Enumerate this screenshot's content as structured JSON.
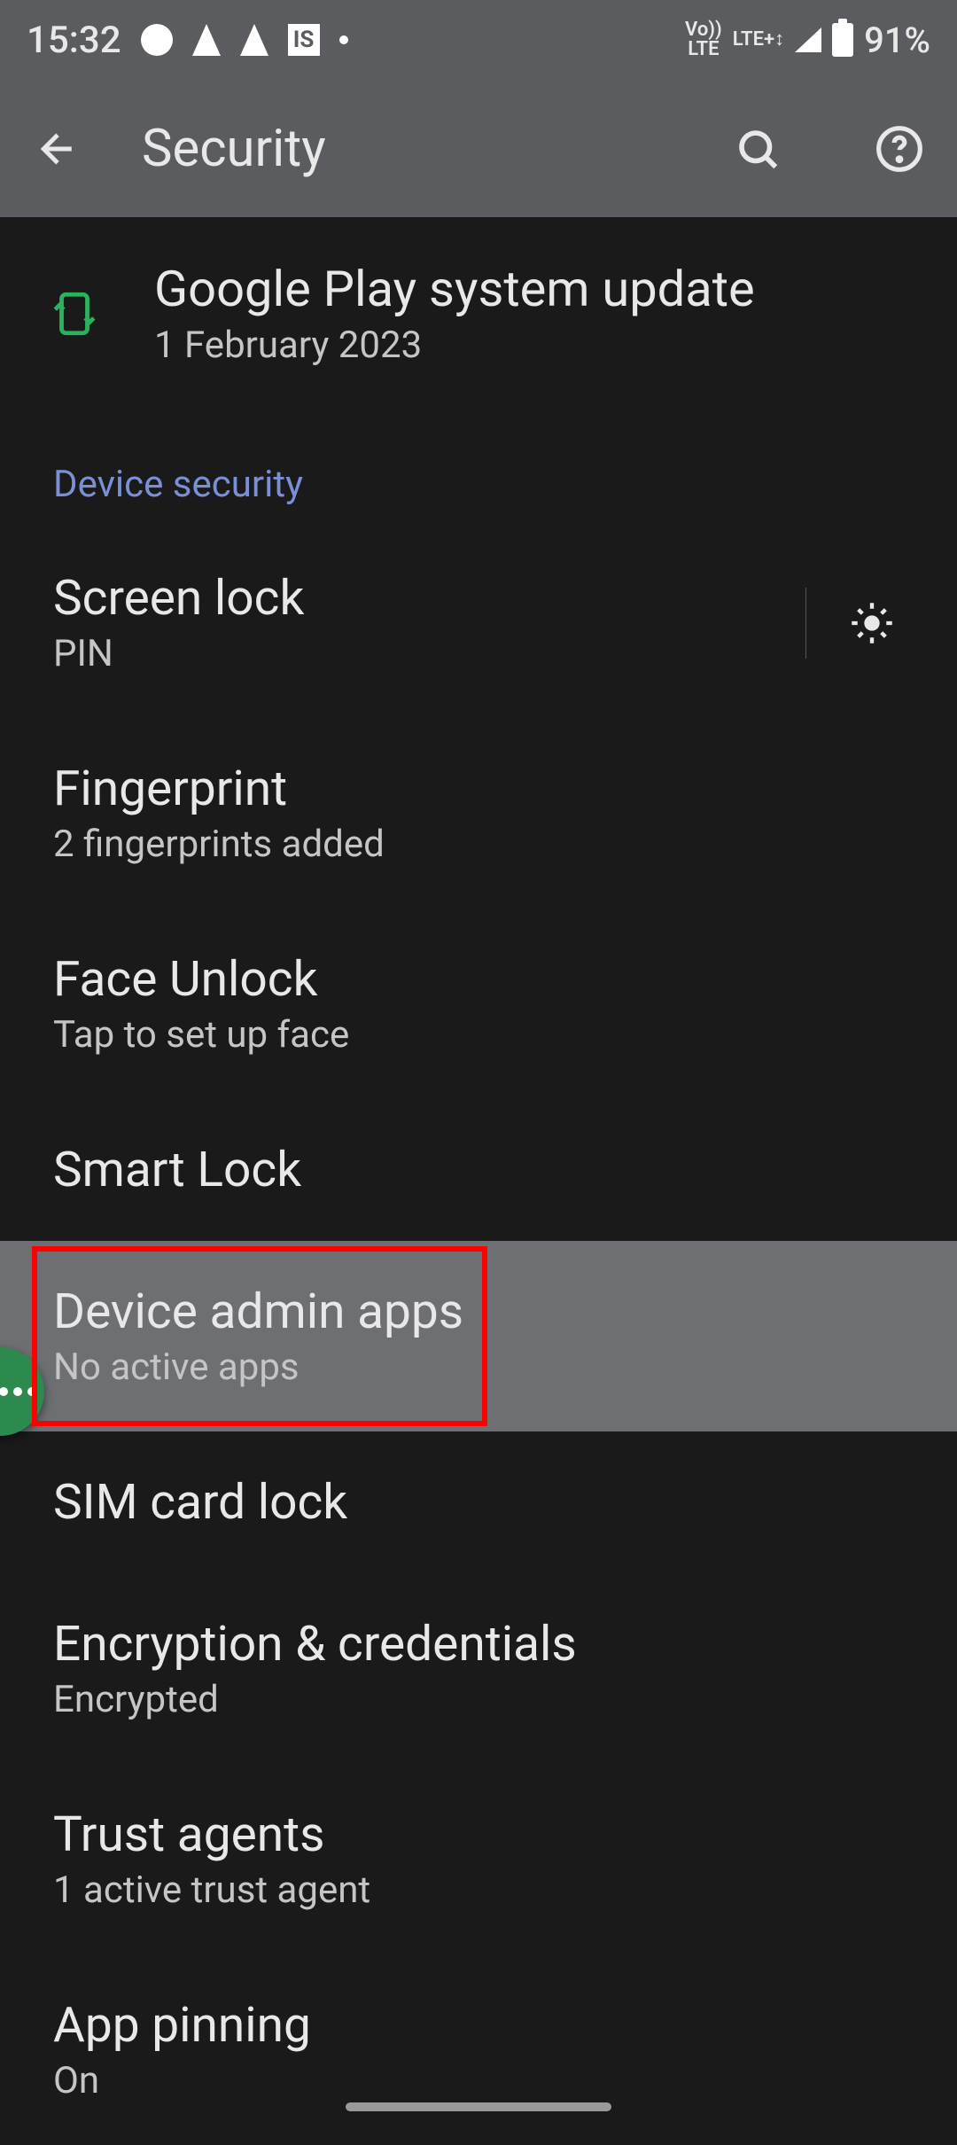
{
  "status": {
    "time": "15:32",
    "square_label": "IS",
    "volte": "Vo))\nLTE",
    "lte": "LTE+↕",
    "battery": "91%"
  },
  "appbar": {
    "title": "Security"
  },
  "update": {
    "title": "Google Play system update",
    "subtitle": "1 February 2023"
  },
  "section_header": "Device security",
  "settings": [
    {
      "title": "Screen lock",
      "subtitle": "PIN",
      "gear": true
    },
    {
      "title": "Fingerprint",
      "subtitle": "2 fingerprints added"
    },
    {
      "title": "Face Unlock",
      "subtitle": "Tap to set up face"
    },
    {
      "title": "Smart Lock",
      "subtitle": ""
    },
    {
      "title": "Device admin apps",
      "subtitle": "No active apps",
      "highlighted": true
    },
    {
      "title": "SIM card lock",
      "subtitle": ""
    },
    {
      "title": "Encryption & credentials",
      "subtitle": "Encrypted"
    },
    {
      "title": "Trust agents",
      "subtitle": "1 active trust agent"
    },
    {
      "title": "App pinning",
      "subtitle": "On"
    }
  ]
}
